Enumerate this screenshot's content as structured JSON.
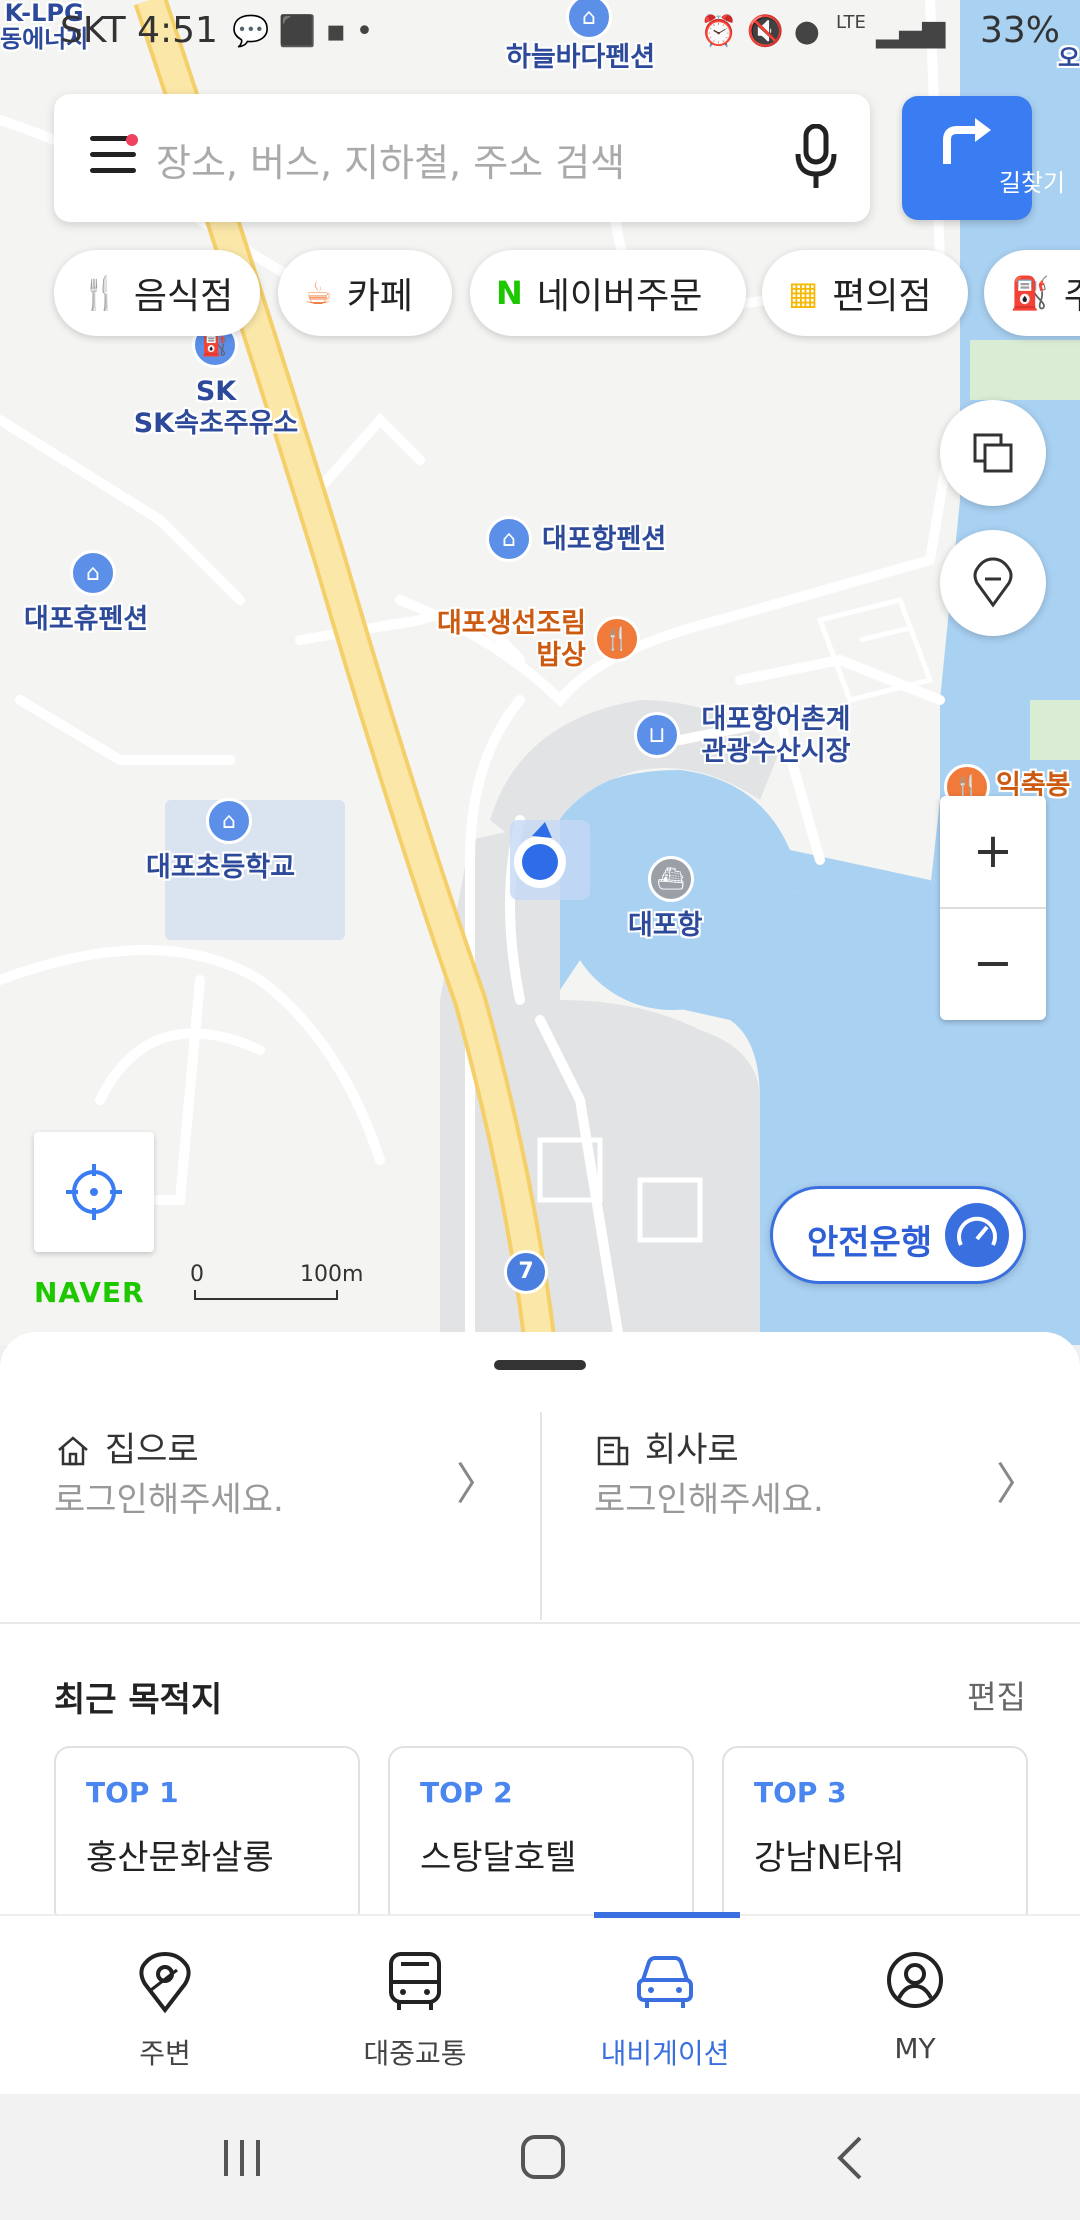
{
  "status_bar": {
    "carrier_time": "SKT 4:51",
    "battery": "33%",
    "network": "LTE"
  },
  "search": {
    "placeholder": "장소, 버스, 지하철, 주소 검색",
    "route_label": "길찾기"
  },
  "chips": [
    {
      "label": "음식점",
      "icon": "restaurant-icon",
      "color": "#f07a3a"
    },
    {
      "label": "카페",
      "icon": "cafe-icon",
      "color": "#f07a3a"
    },
    {
      "label": "네이버주문",
      "icon": "naver-n-icon",
      "color": "#1ec800"
    },
    {
      "label": "편의점",
      "icon": "store-icon",
      "color": "#f6b800"
    },
    {
      "label": "주",
      "icon": "gas-icon",
      "color": "#3a7cf2"
    }
  ],
  "map": {
    "labels": {
      "lpg_1": "K-LPG",
      "lpg_2": "동에너지",
      "pension_top": "하늘바다펜션",
      "sk_1": "SK",
      "sk_2": "SK속초주유소",
      "daepo_hang_pension": "대포항펜션",
      "daepo_hyu_pension": "대포휴펜션",
      "restaurant_1": "대포생선조림",
      "restaurant_2": "밥상",
      "market_1": "대포항어촌계",
      "market_2": "관광수산시장",
      "iksukbong": "익축봉",
      "school": "대포초등학교",
      "port": "대포항",
      "right_top": "오"
    },
    "road_number": "7",
    "scale_start": "0",
    "scale_end": "100m",
    "naver_logo": "NAVER",
    "safe_drive": "안전운행",
    "zoom_in": "+",
    "zoom_out": "−"
  },
  "favorites": {
    "home_title": "집으로",
    "home_sub": "로그인해주세요.",
    "work_title": "회사로",
    "work_sub": "로그인해주세요."
  },
  "recent": {
    "title": "최근 목적지",
    "edit": "편집",
    "items": [
      {
        "rank": "TOP 1",
        "place": "홍산문화살롱"
      },
      {
        "rank": "TOP 2",
        "place": "스탕달호텔"
      },
      {
        "rank": "TOP 3",
        "place": "강남N타워"
      }
    ]
  },
  "bottom_nav": [
    {
      "label": "주변",
      "icon": "pin-icon"
    },
    {
      "label": "대중교통",
      "icon": "bus-icon"
    },
    {
      "label": "내비게이션",
      "icon": "car-icon",
      "active": true
    },
    {
      "label": "MY",
      "icon": "person-icon"
    }
  ]
}
